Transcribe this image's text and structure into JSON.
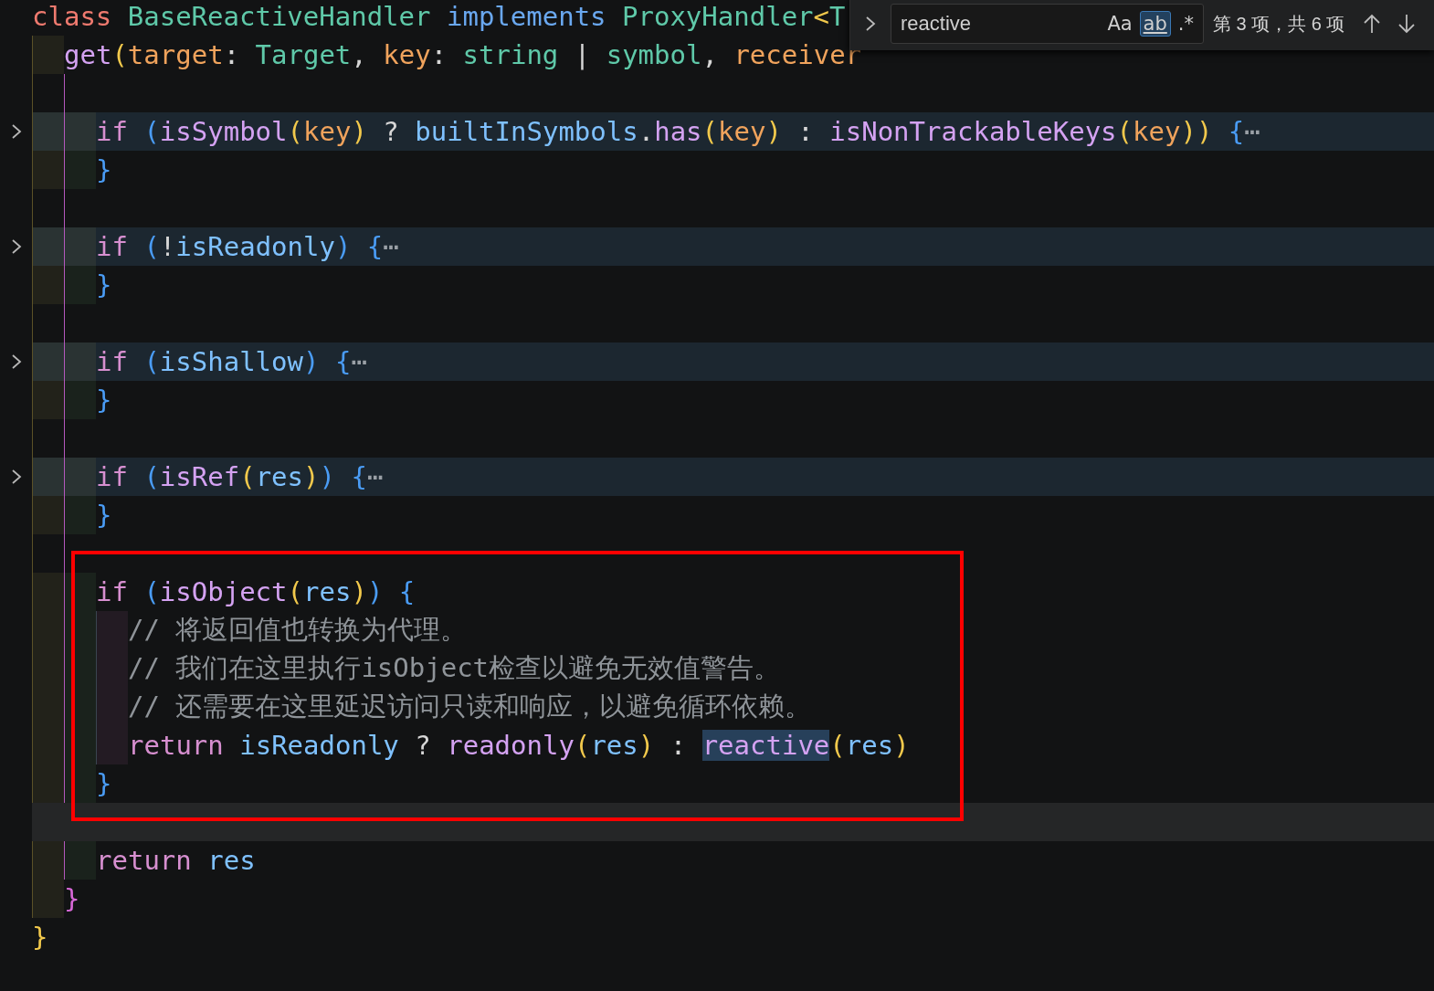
{
  "find_widget": {
    "replace_expanded": false,
    "value": "reactive",
    "toggles": [
      {
        "label": "Aa",
        "selected": false
      },
      {
        "label": "ab",
        "selected": true
      },
      {
        "label": ".*",
        "selected": false
      }
    ],
    "match_count": "第 3 项，共 6 项"
  },
  "lines": [
    {
      "kind": "code",
      "tokens": [
        {
          "text": "class ",
          "kind": "keyword"
        },
        {
          "text": "BaseReactiveHandler ",
          "kind": "type"
        },
        {
          "text": "implements ",
          "kind": "storage"
        },
        {
          "text": "ProxyHandler",
          "kind": "type"
        },
        {
          "text": "<",
          "kind": "bracket1"
        },
        {
          "text": "T",
          "kind": "type"
        }
      ],
      "children": [
        {
          "kind": "code",
          "tokens": [
            {
              "text": "get",
              "kind": "function"
            },
            {
              "text": "(",
              "kind": "bracket1"
            },
            {
              "text": "target",
              "kind": "param"
            },
            {
              "text": ": ",
              "kind": "punct"
            },
            {
              "text": "Target",
              "kind": "type"
            },
            {
              "text": ", ",
              "kind": "punct"
            },
            {
              "text": "key",
              "kind": "param"
            },
            {
              "text": ": ",
              "kind": "punct"
            },
            {
              "text": "string",
              "kind": "type"
            },
            {
              "text": " | ",
              "kind": "punct"
            },
            {
              "text": "symbol",
              "kind": "type"
            },
            {
              "text": ", ",
              "kind": "punct"
            },
            {
              "text": "receiver",
              "kind": "param"
            }
          ],
          "children": [
            {
              "kind": "blank"
            },
            {
              "kind": "folded",
              "tokens": [
                {
                  "text": "if ",
                  "kind": "control"
                },
                {
                  "text": "(",
                  "kind": "bracket3"
                },
                {
                  "text": "isSymbol",
                  "kind": "function"
                },
                {
                  "text": "(",
                  "kind": "bracket1"
                },
                {
                  "text": "key",
                  "kind": "param"
                },
                {
                  "text": ")",
                  "kind": "bracket1"
                },
                {
                  "text": " ? ",
                  "kind": "punct"
                },
                {
                  "text": "builtInSymbols",
                  "kind": "variable"
                },
                {
                  "text": ".",
                  "kind": "punct"
                },
                {
                  "text": "has",
                  "kind": "function"
                },
                {
                  "text": "(",
                  "kind": "bracket1"
                },
                {
                  "text": "key",
                  "kind": "param"
                },
                {
                  "text": ")",
                  "kind": "bracket1"
                },
                {
                  "text": " : ",
                  "kind": "punct"
                },
                {
                  "text": "isNonTrackableKeys",
                  "kind": "function"
                },
                {
                  "text": "(",
                  "kind": "bracket1"
                },
                {
                  "text": "key",
                  "kind": "param"
                },
                {
                  "text": "))",
                  "kind": "bracket1"
                },
                {
                  "text": " {",
                  "kind": "bracket3"
                },
                {
                  "text": "⋯",
                  "kind": "ellipsis"
                }
              ]
            },
            {
              "kind": "code",
              "tokens": [
                {
                  "text": "}",
                  "kind": "bracket3"
                }
              ]
            },
            {
              "kind": "blank"
            },
            {
              "kind": "folded",
              "tokens": [
                {
                  "text": "if ",
                  "kind": "control"
                },
                {
                  "text": "(",
                  "kind": "bracket3"
                },
                {
                  "text": "!",
                  "kind": "punct"
                },
                {
                  "text": "isReadonly",
                  "kind": "variable"
                },
                {
                  "text": ")",
                  "kind": "bracket3"
                },
                {
                  "text": " {",
                  "kind": "bracket3"
                },
                {
                  "text": "⋯",
                  "kind": "ellipsis"
                }
              ]
            },
            {
              "kind": "code",
              "tokens": [
                {
                  "text": "}",
                  "kind": "bracket3"
                }
              ]
            },
            {
              "kind": "blank"
            },
            {
              "kind": "folded",
              "tokens": [
                {
                  "text": "if ",
                  "kind": "control"
                },
                {
                  "text": "(",
                  "kind": "bracket3"
                },
                {
                  "text": "isShallow",
                  "kind": "variable"
                },
                {
                  "text": ")",
                  "kind": "bracket3"
                },
                {
                  "text": " {",
                  "kind": "bracket3"
                },
                {
                  "text": "⋯",
                  "kind": "ellipsis"
                }
              ]
            },
            {
              "kind": "code",
              "tokens": [
                {
                  "text": "}",
                  "kind": "bracket3"
                }
              ]
            },
            {
              "kind": "blank"
            },
            {
              "kind": "folded",
              "tokens": [
                {
                  "text": "if ",
                  "kind": "control"
                },
                {
                  "text": "(",
                  "kind": "bracket3"
                },
                {
                  "text": "isRef",
                  "kind": "function"
                },
                {
                  "text": "(",
                  "kind": "bracket1"
                },
                {
                  "text": "res",
                  "kind": "variable"
                },
                {
                  "text": ")",
                  "kind": "bracket1"
                },
                {
                  "text": ")",
                  "kind": "bracket3"
                },
                {
                  "text": " {",
                  "kind": "bracket3"
                },
                {
                  "text": "⋯",
                  "kind": "ellipsis"
                }
              ]
            },
            {
              "kind": "code",
              "tokens": [
                {
                  "text": "}",
                  "kind": "bracket3"
                }
              ]
            },
            {
              "kind": "blank"
            },
            {
              "kind": "boxed_group",
              "children": [
                {
                  "kind": "code",
                  "tokens": [
                    {
                      "text": "if ",
                      "kind": "control"
                    },
                    {
                      "text": "(",
                      "kind": "bracket3"
                    },
                    {
                      "text": "isObject",
                      "kind": "function"
                    },
                    {
                      "text": "(",
                      "kind": "bracket1"
                    },
                    {
                      "text": "res",
                      "kind": "variable"
                    },
                    {
                      "text": ")",
                      "kind": "bracket1"
                    },
                    {
                      "text": ")",
                      "kind": "bracket3"
                    },
                    {
                      "text": " {",
                      "kind": "bracket3"
                    }
                  ],
                  "children": [
                    {
                      "kind": "code",
                      "tokens": [
                        {
                          "text": "// 将返回值也转换为代理。",
                          "kind": "comment"
                        }
                      ]
                    },
                    {
                      "kind": "code",
                      "tokens": [
                        {
                          "text": "// 我们在这里执行isObject检查以避免无效值警告。",
                          "kind": "comment"
                        }
                      ]
                    },
                    {
                      "kind": "code",
                      "tokens": [
                        {
                          "text": "// 还需要在这里延迟访问只读和响应，以避免循环依赖。",
                          "kind": "comment"
                        }
                      ]
                    },
                    {
                      "kind": "code",
                      "tokens": [
                        {
                          "text": "return ",
                          "kind": "control"
                        },
                        {
                          "text": "isReadonly",
                          "kind": "variable"
                        },
                        {
                          "text": " ? ",
                          "kind": "punct"
                        },
                        {
                          "text": "readonly",
                          "kind": "function"
                        },
                        {
                          "text": "(",
                          "kind": "bracket1"
                        },
                        {
                          "text": "res",
                          "kind": "variable"
                        },
                        {
                          "text": ")",
                          "kind": "bracket1"
                        },
                        {
                          "text": " : ",
                          "kind": "punct"
                        },
                        {
                          "text": "reactive",
                          "kind": "search_match"
                        },
                        {
                          "text": "(",
                          "kind": "bracket1"
                        },
                        {
                          "text": "res",
                          "kind": "variable"
                        },
                        {
                          "text": ")",
                          "kind": "bracket1"
                        }
                      ]
                    }
                  ]
                },
                {
                  "kind": "code",
                  "tokens": [
                    {
                      "text": "}",
                      "kind": "bracket3"
                    }
                  ]
                }
              ]
            },
            {
              "kind": "cursor"
            },
            {
              "kind": "code",
              "tokens": [
                {
                  "text": "return ",
                  "kind": "control"
                },
                {
                  "text": "res",
                  "kind": "variable"
                }
              ]
            }
          ]
        },
        {
          "kind": "code",
          "tokens": [
            {
              "text": "}",
              "kind": "bracket2"
            }
          ]
        }
      ]
    },
    {
      "kind": "code",
      "tokens": [
        {
          "text": "}",
          "kind": "bracket1"
        }
      ]
    }
  ]
}
